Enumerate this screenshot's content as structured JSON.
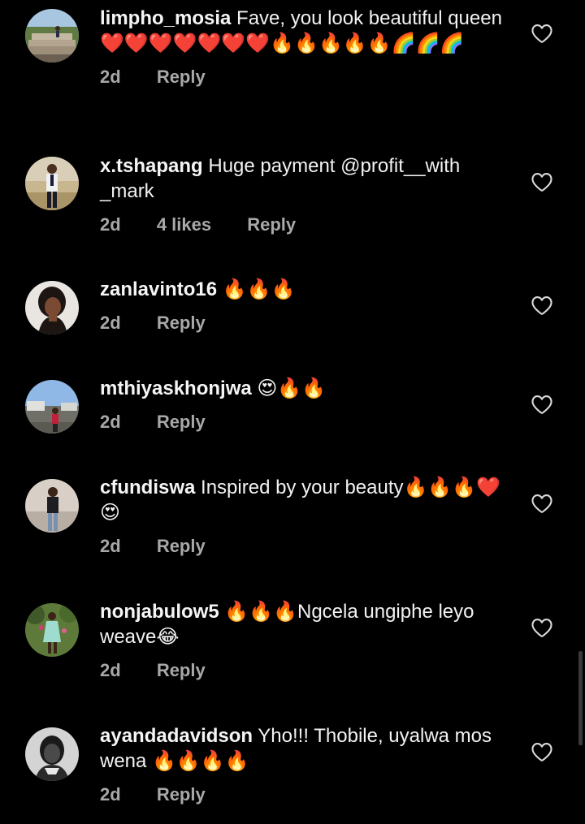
{
  "comments": [
    {
      "username": "limpho_mosia",
      "text": "Fave, you look beautiful queen❤️❤️❤️❤️❤️❤️❤️🔥🔥🔥🔥🔥🌈🌈🌈",
      "time": "2d",
      "likes": "",
      "reply": "Reply",
      "avatar_icon": "avatar-outdoor-steps"
    },
    {
      "username": "x.tshapang",
      "text": "Huge payment @profit__with _mark",
      "time": "2d",
      "likes": "4 likes",
      "reply": "Reply",
      "avatar_icon": "avatar-man-standing"
    },
    {
      "username": "zanlavinto16",
      "text": "🔥🔥🔥",
      "time": "2d",
      "likes": "",
      "reply": "Reply",
      "avatar_icon": "avatar-woman-portrait"
    },
    {
      "username": "mthiyaskhonjwa",
      "text": "😍🔥🔥",
      "time": "2d",
      "likes": "",
      "reply": "Reply",
      "avatar_icon": "avatar-outdoor-sky"
    },
    {
      "username": "cfundiswa",
      "text": "Inspired by your beauty🔥🔥🔥❤️😍",
      "time": "2d",
      "likes": "",
      "reply": "Reply",
      "avatar_icon": "avatar-woman-wall"
    },
    {
      "username": "nonjabulow5",
      "text": "🔥🔥🔥Ngcela ungiphe leyo weave😂",
      "time": "2d",
      "likes": "",
      "reply": "Reply",
      "avatar_icon": "avatar-woman-garden"
    },
    {
      "username": "ayandadavidson",
      "text": "Yho!!! Thobile, uyalwa mos wena 🔥🔥🔥🔥",
      "time": "2d",
      "likes": "",
      "reply": "Reply",
      "avatar_icon": "avatar-bw-portrait"
    }
  ],
  "like_icon": "heart-outline-icon",
  "colors": {
    "background": "#000000",
    "text": "#f2f2f2",
    "meta": "#a8a8a8",
    "icon": "#d9d9d9"
  }
}
